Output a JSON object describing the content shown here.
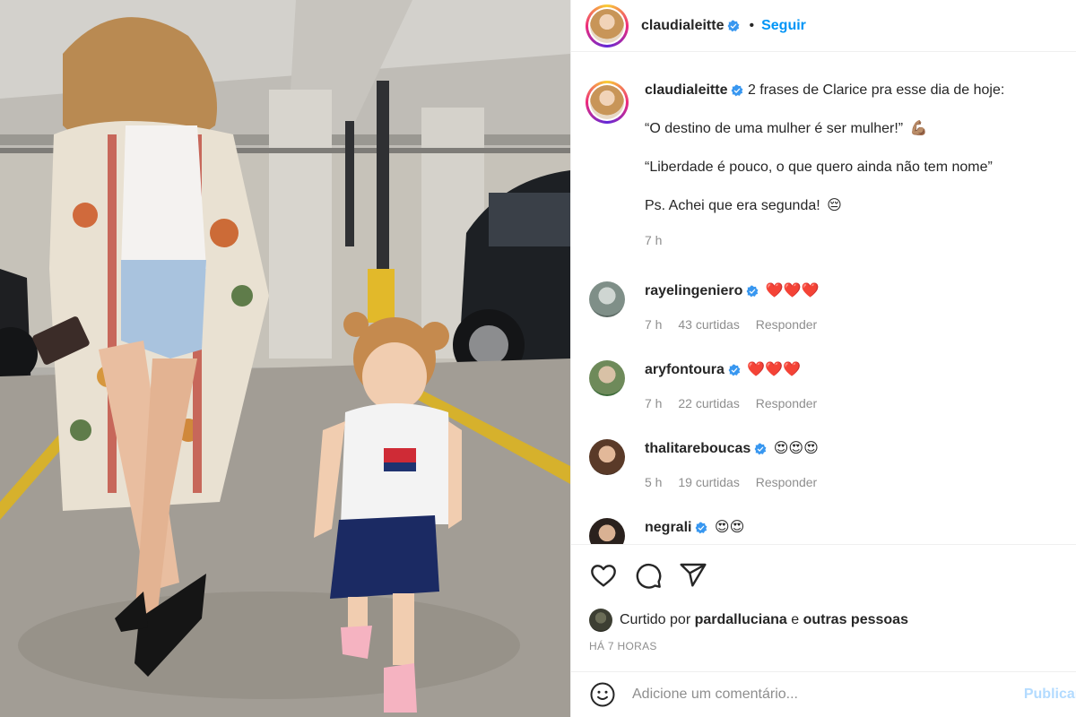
{
  "post": {
    "author": "claudialeitte",
    "follow_separator": "•",
    "follow_label": "Seguir",
    "caption": {
      "username": "claudialeitte",
      "first_line": "2 frases de Clarice pra esse dia de hoje:",
      "line2": "“O destino de uma mulher é ser mulher!”",
      "line2_emoji": "💪🏽",
      "line3": "“Liberdade é pouco, o que quero ainda não tem nome”",
      "line4": "Ps. Achei que era segunda!",
      "line4_emoji": "😔",
      "time": "7 h"
    },
    "comments": [
      {
        "username": "rayelingeniero",
        "text": "❤️❤️❤️",
        "time": "7 h",
        "likes": "43 curtidas",
        "reply": "Responder"
      },
      {
        "username": "aryfontoura",
        "text": "❤️❤️❤️",
        "time": "7 h",
        "likes": "22 curtidas",
        "reply": "Responder"
      },
      {
        "username": "thalitareboucas",
        "text": "😍😍😍",
        "time": "5 h",
        "likes": "19 curtidas",
        "reply": "Responder"
      },
      {
        "username": "negrali",
        "text": "😍😍"
      }
    ],
    "liked_by": {
      "prefix": "Curtido por",
      "user": "pardalluciana",
      "conjunction": "e",
      "others": "outras pessoas"
    },
    "time_ago": "HÁ 7 HORAS",
    "comment_placeholder": "Adicione um comentário...",
    "publish_label": "Publicar"
  },
  "icons": {
    "like": "heart-icon",
    "comment": "comment-icon",
    "share": "share-icon",
    "emoji": "smiley-icon",
    "verified": "verified-badge-icon"
  },
  "colors": {
    "accent": "#0095f6",
    "verified": "#3897f0",
    "muted": "#8e8e8e",
    "text": "#262626",
    "publish_disabled": "#b3dbff"
  }
}
